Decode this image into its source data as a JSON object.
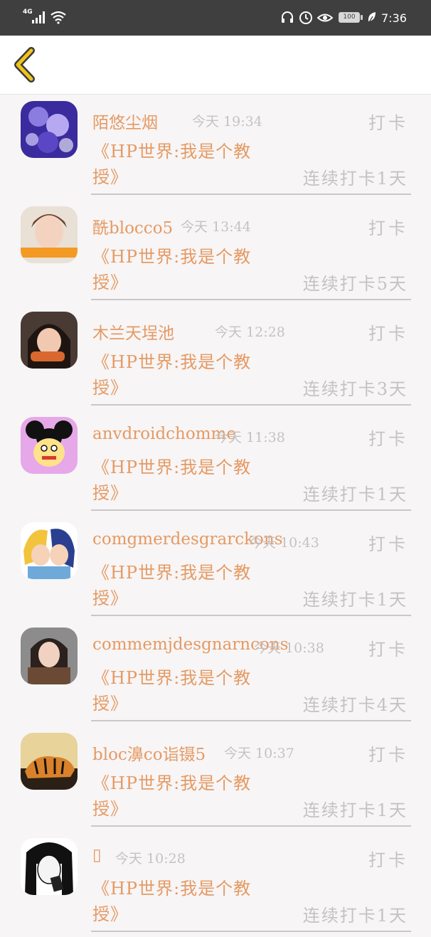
{
  "status_bar": {
    "network": "4G",
    "battery": "100",
    "time": "7:36"
  },
  "header": {
    "back_icon": "chevron-left-icon",
    "accent_color": "#f0c419"
  },
  "colors": {
    "accent_text": "#e59a63",
    "muted_text": "#c4c2c3"
  },
  "checkins": [
    {
      "name": "陌悠尘烟",
      "time": "今天 19:34",
      "action": "打卡",
      "book": "《HP世界:我是个教授》",
      "streak": "连续打卡1天",
      "avatar": "avatar-1"
    },
    {
      "name": "酰blocco5",
      "time": "今天 13:44",
      "action": "打卡",
      "book": "《HP世界:我是个教授》",
      "streak": "连续打卡5天",
      "avatar": "avatar-2"
    },
    {
      "name": "木兰天埕池",
      "time": "今天 12:28",
      "action": "打卡",
      "book": "《HP世界:我是个教授》",
      "streak": "连续打卡3天",
      "avatar": "avatar-3"
    },
    {
      "name": "anvdroidchomme",
      "time": "今天 11:38",
      "action": "打卡",
      "book": "《HP世界:我是个教授》",
      "streak": "连续打卡1天",
      "avatar": "avatar-4"
    },
    {
      "name": "comgmerdesgrarckons",
      "time": "今天 10:43",
      "action": "打卡",
      "book": "《HP世界:我是个教授》",
      "streak": "连续打卡1天",
      "avatar": "avatar-5"
    },
    {
      "name": "commemjdesgnarncons",
      "time": "今天 10:38",
      "action": "打卡",
      "book": "《HP世界:我是个教授》",
      "streak": "连续打卡4天",
      "avatar": "avatar-6"
    },
    {
      "name": "bloc濞co诣镊5",
      "time": "今天 10:37",
      "action": "打卡",
      "book": "《HP世界:我是个教授》",
      "streak": "连续打卡1天",
      "avatar": "avatar-7"
    },
    {
      "name": "▯",
      "time": "今天 10:28",
      "action": "打卡",
      "book": "《HP世界:我是个教授》",
      "streak": "连续打卡1天",
      "avatar": "avatar-8"
    }
  ]
}
